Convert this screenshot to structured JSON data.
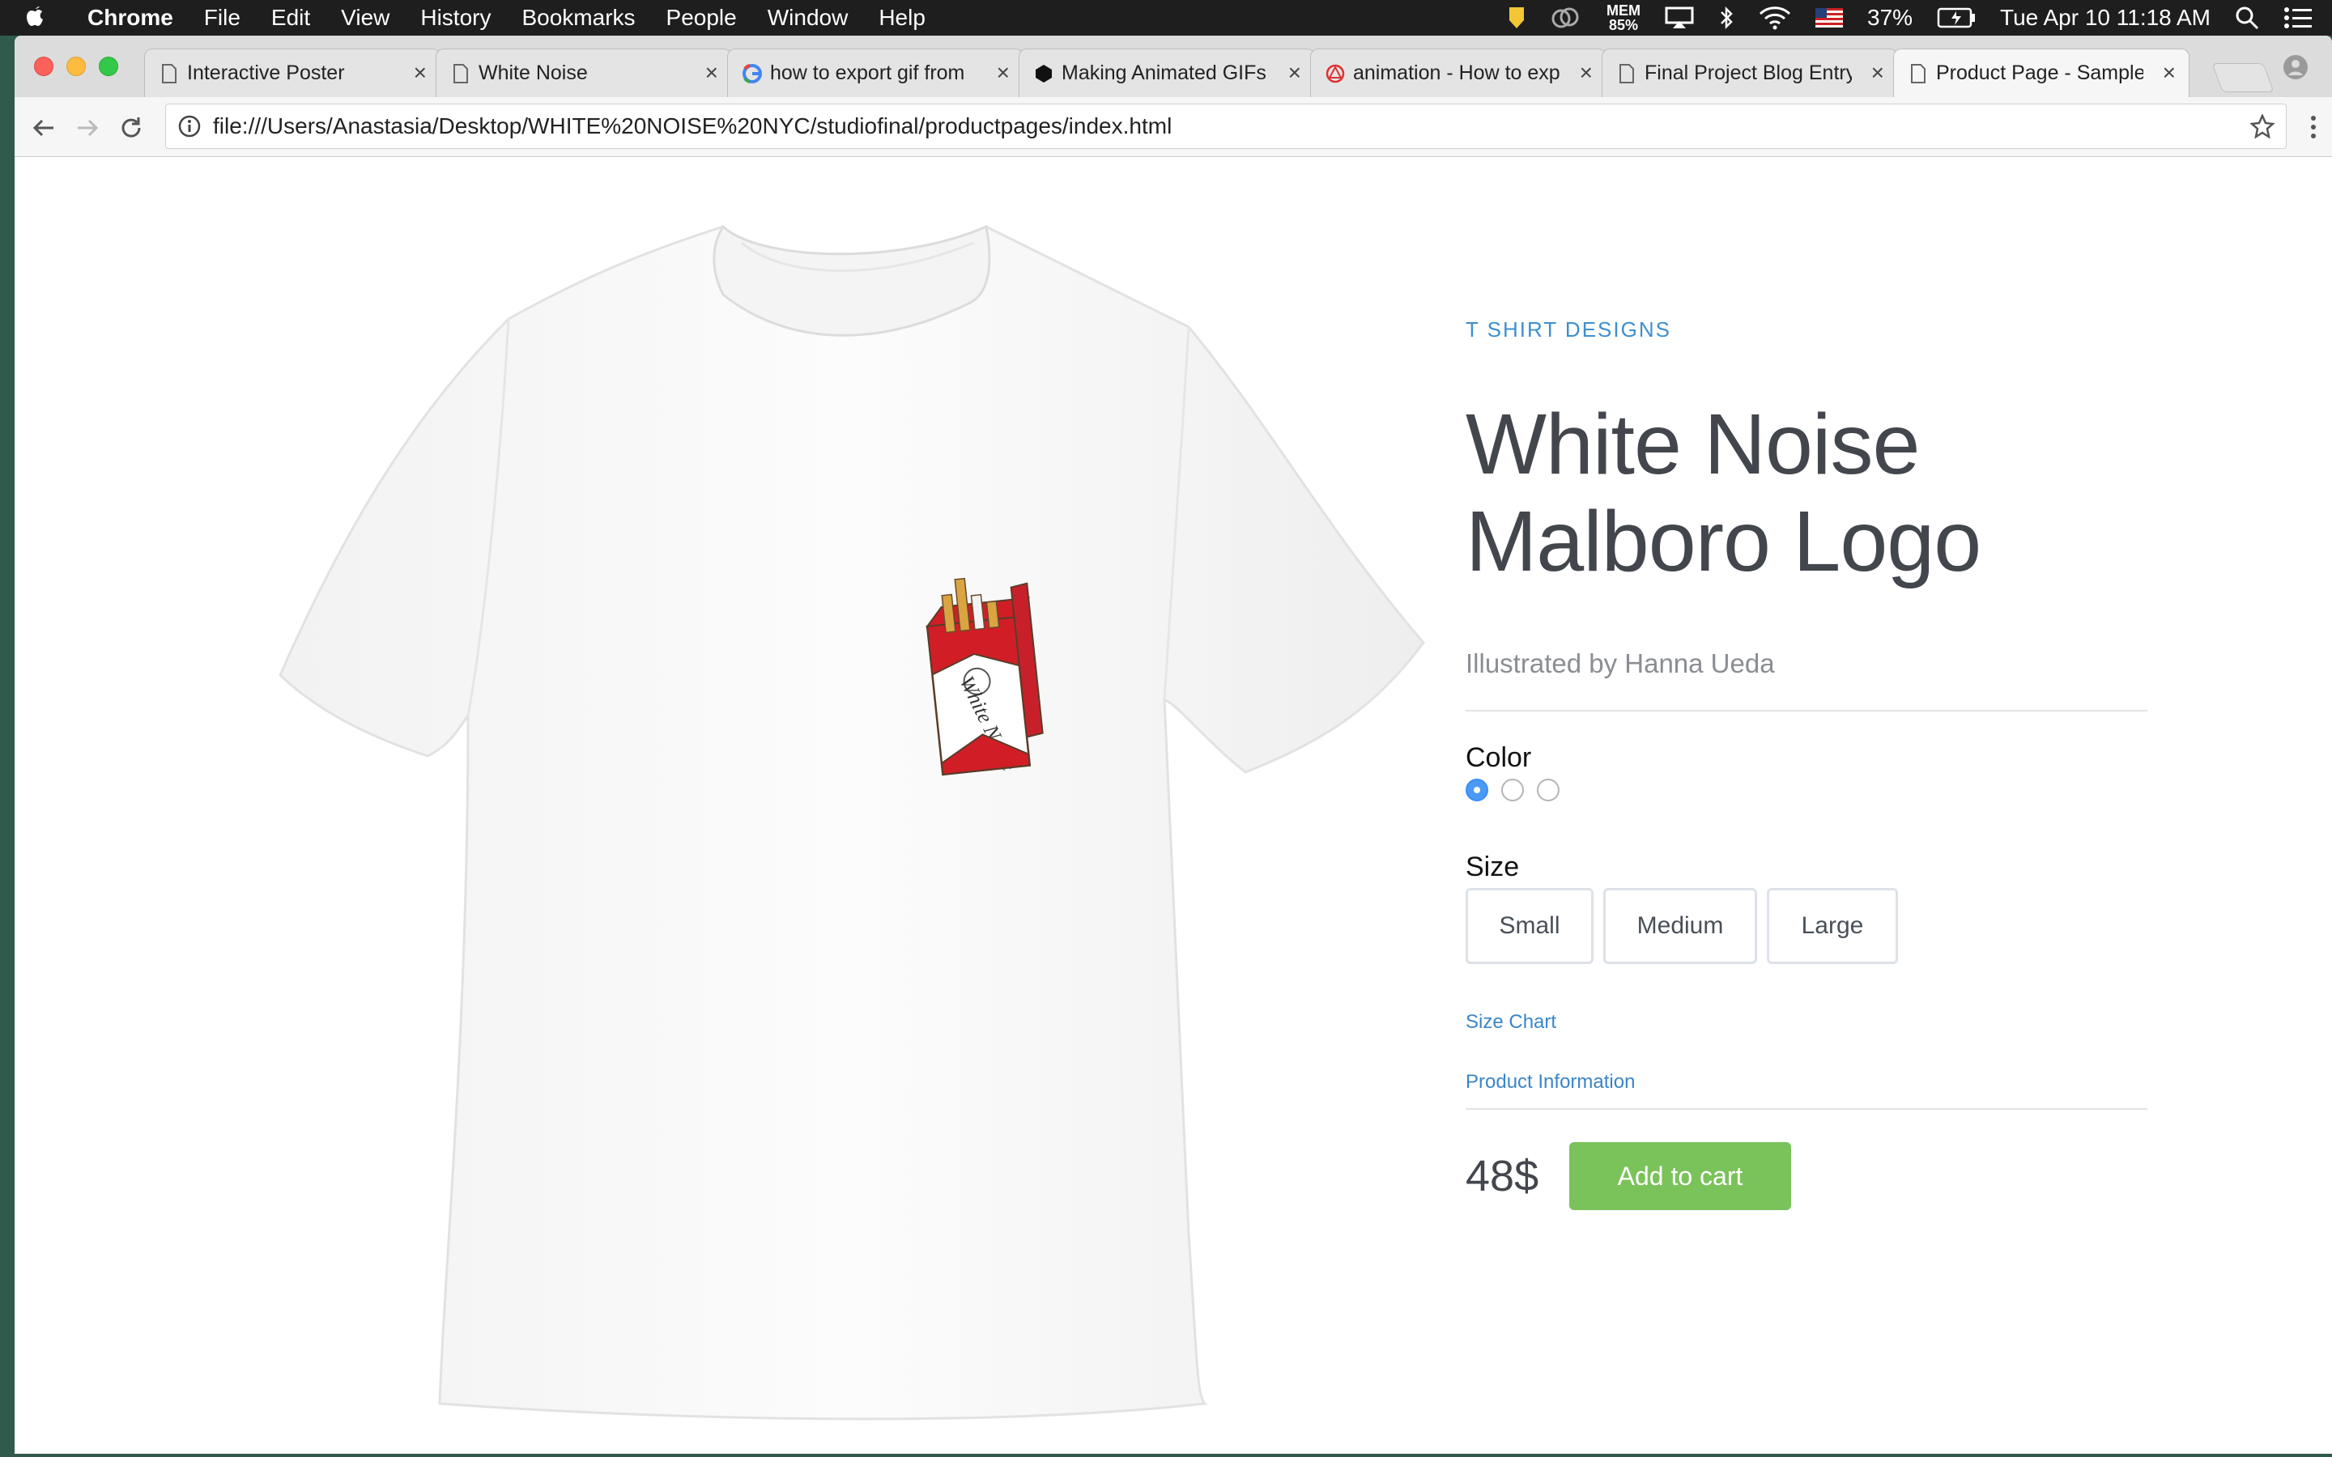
{
  "menubar": {
    "app_name": "Chrome",
    "menus": [
      "File",
      "Edit",
      "View",
      "History",
      "Bookmarks",
      "People",
      "Window",
      "Help"
    ],
    "status": {
      "mem_label": "MEM",
      "mem_value": "85%",
      "battery": "37%",
      "datetime": "Tue Apr 10  11:18 AM"
    }
  },
  "browser": {
    "tabs": [
      {
        "title": "Interactive Poster",
        "icon": "page-icon",
        "active": false
      },
      {
        "title": "White Noise",
        "icon": "page-icon",
        "active": false
      },
      {
        "title": "how to export gif from",
        "icon": "google-icon",
        "active": false
      },
      {
        "title": "Making Animated GIFs",
        "icon": "site-icon",
        "active": false
      },
      {
        "title": "animation - How to exp",
        "icon": "site-icon",
        "active": false
      },
      {
        "title": "Final Project Blog Entry",
        "icon": "page-icon",
        "active": false
      },
      {
        "title": "Product Page - Sample",
        "icon": "page-icon",
        "active": true
      }
    ],
    "url": "file:///Users/Anastasia/Desktop/WHITE%20NOISE%20NYC/studiofinal/productpages/index.html"
  },
  "product": {
    "category": "T SHIRT DESIGNS",
    "title_line1": "White Noise",
    "title_line2": "Malboro Logo",
    "subtitle": "Illustrated by Hanna Ueda",
    "color_label": "Color",
    "color_options_selected_index": 0,
    "size_label": "Size",
    "sizes": [
      "Small",
      "Medium",
      "Large"
    ],
    "size_chart_link": "Size Chart",
    "product_info_link": "Product Information",
    "price": "48$",
    "add_to_cart": "Add to cart",
    "image_text": "White Noise"
  },
  "colors": {
    "accent_blue": "#3e8fd0",
    "button_green": "#7ac25a",
    "pack_red": "#c8202a"
  }
}
